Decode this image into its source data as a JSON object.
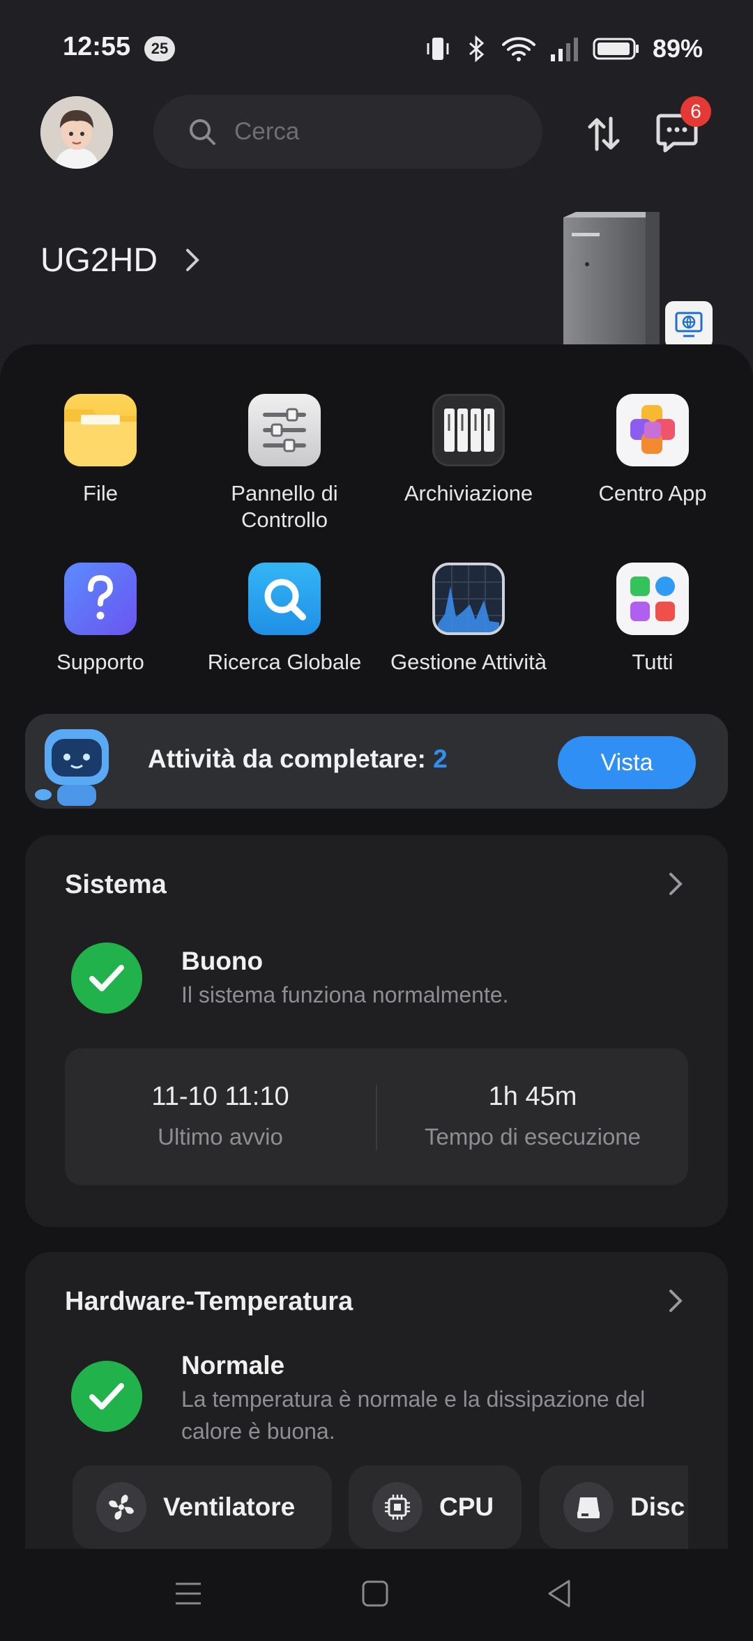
{
  "status_bar": {
    "time": "12:55",
    "notification_count": "25",
    "battery": "89%"
  },
  "header": {
    "search_placeholder": "Cerca",
    "messages_badge": "6"
  },
  "device": {
    "name": "UG2HD"
  },
  "apps": [
    {
      "label": "File",
      "icon": "folder-icon"
    },
    {
      "label": "Pannello di Controllo",
      "icon": "sliders-icon"
    },
    {
      "label": "Archiviazione",
      "icon": "drives-icon"
    },
    {
      "label": "Centro App",
      "icon": "app-center-icon"
    },
    {
      "label": "Supporto",
      "icon": "help-icon"
    },
    {
      "label": "Ricerca Globale",
      "icon": "global-search-icon"
    },
    {
      "label": "Gestione Attività",
      "icon": "activity-monitor-icon"
    },
    {
      "label": "Tutti",
      "icon": "all-apps-icon"
    }
  ],
  "tasks": {
    "label": "Attività da completare:",
    "count": "2",
    "button": "Vista"
  },
  "system": {
    "title": "Sistema",
    "status_title": "Buono",
    "status_sub": "Il sistema funziona normalmente.",
    "last_boot_value": "11-10 11:10",
    "last_boot_label": "Ultimo avvio",
    "uptime_value": "1h 45m",
    "uptime_label": "Tempo di esecuzione"
  },
  "hardware": {
    "title": "Hardware-Temperatura",
    "status_title": "Normale",
    "status_sub": "La temperatura è normale e la dissipazione del calore è buona.",
    "chips": [
      "Ventilatore",
      "CPU",
      "Disc"
    ]
  },
  "colors": {
    "accent": "#2f8ff5",
    "ok": "#22b24c",
    "badge": "#e53935"
  }
}
